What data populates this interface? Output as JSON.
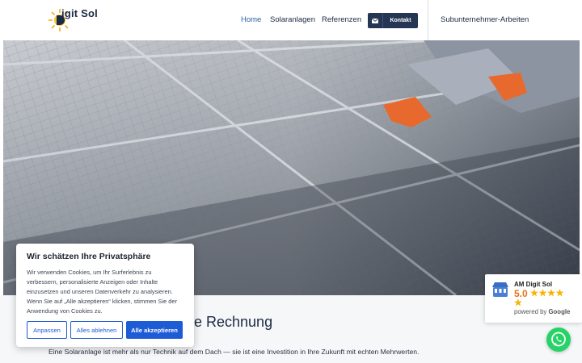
{
  "header": {
    "logo_text": "igit Sol",
    "logo_letter": "D",
    "nav": [
      {
        "label": "Home",
        "active": true
      },
      {
        "label": "Solaranlagen"
      },
      {
        "label": "Referenzen"
      }
    ],
    "contact_label": "Kontakt",
    "contact_icon": "envelope-icon",
    "subcontractor_label": "Subunternehmer-Arbeiten"
  },
  "main": {
    "heading_visible": "e Rechnung",
    "paragraph": "Eine Solaranlage ist mehr als nur Technik auf dem Dach — sie ist eine Investition in Ihre Zukunft mit echten Mehrwerten."
  },
  "cookie_banner": {
    "title": "Wir schätzen Ihre Privatsphäre",
    "text": "Wir verwenden Cookies, um Ihr Surferlebnis zu verbessern, personalisierte Anzeigen oder Inhalte einzusetzen und unseren Datenverkehr zu analysieren. Wenn Sie auf „Alle akzeptieren“ klicken, stimmen Sie der Anwendung von Cookies zu.",
    "btn_customize": "Anpassen",
    "btn_reject": "Alles ablehnen",
    "btn_accept": "Alle akzeptieren"
  },
  "google_badge": {
    "name": "AM Digit Sol",
    "rating": "5.0",
    "stars": 5,
    "powered_by": "powered by",
    "google": "Google"
  },
  "colors": {
    "brand_dark": "#243653",
    "accent_blue": "#1e5bd6",
    "nav_active": "#2c5ea8",
    "whatsapp": "#25d366",
    "star": "#f5b400"
  }
}
